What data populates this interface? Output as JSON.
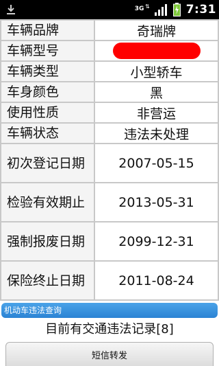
{
  "status_bar": {
    "network_label": "3G",
    "time": "7:31"
  },
  "vehicle_info": [
    {
      "key": "车辆品牌",
      "value": "奇瑞牌"
    },
    {
      "key": "车辆型号",
      "value": "",
      "redacted": true
    },
    {
      "key": "车辆类型",
      "value": "小型轿车"
    },
    {
      "key": "车身颜色",
      "value": "黑"
    },
    {
      "key": "使用性质",
      "value": "非营运"
    },
    {
      "key": "车辆状态",
      "value": "违法未处理"
    },
    {
      "key": "初次登记日期",
      "value": "2007-05-15"
    },
    {
      "key": "检验有效期止",
      "value": "2013-05-31"
    },
    {
      "key": "强制报废日期",
      "value": "2099-12-31"
    },
    {
      "key": "保险终止日期",
      "value": "2011-08-24"
    }
  ],
  "section": {
    "title": "机动车违法查询"
  },
  "violation_summary": "目前有交通违法记录[8]",
  "sms_button_label": "短信转发",
  "colors": {
    "section_bar": "#2b83d4",
    "redaction": "#ff0000",
    "cell_border": "#c8c8c8"
  }
}
